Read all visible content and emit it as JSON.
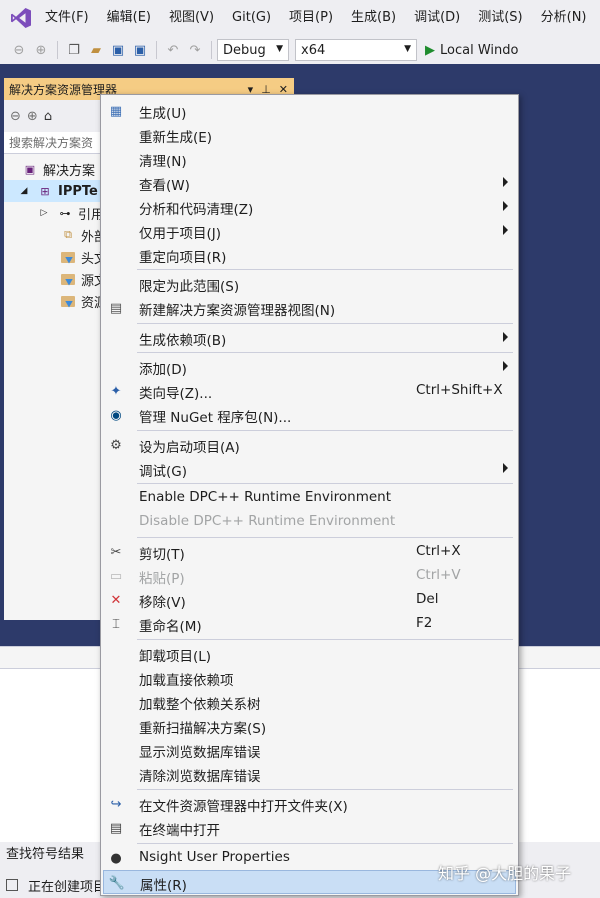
{
  "menubar": {
    "items": [
      "文件(F)",
      "编辑(E)",
      "视图(V)",
      "Git(G)",
      "项目(P)",
      "生成(B)",
      "调试(D)",
      "测试(S)",
      "分析(N)"
    ]
  },
  "toolbar": {
    "configuration": "Debug",
    "platform": "x64",
    "run_label": "Local Windo"
  },
  "solution_explorer": {
    "title": "解决方案资源管理器",
    "search_placeholder": "搜索解决方案资",
    "tree": [
      {
        "label": "解决方案",
        "icon": "solution-icon"
      },
      {
        "label": "IPPTe",
        "icon": "project-icon",
        "selected": true
      },
      {
        "label": "引用",
        "icon": "references-icon"
      },
      {
        "label": "外部",
        "icon": "external-deps-icon"
      },
      {
        "label": "头文",
        "icon": "folder-icon"
      },
      {
        "label": "源文",
        "icon": "folder-icon"
      },
      {
        "label": "资源",
        "icon": "folder-icon"
      }
    ]
  },
  "lower": {
    "symbols_tab": "查找符号结果",
    "status": "正在创建项目"
  },
  "context_menu": {
    "items": [
      {
        "label": "生成(U)",
        "icon": "build-icon"
      },
      {
        "label": "重新生成(E)"
      },
      {
        "label": "清理(N)"
      },
      {
        "label": "查看(W)",
        "submenu": true
      },
      {
        "label": "分析和代码清理(Z)",
        "submenu": true
      },
      {
        "label": "仅用于项目(J)",
        "submenu": true
      },
      {
        "label": "重定向项目(R)"
      },
      {
        "label": "限定为此范围(S)"
      },
      {
        "label": "新建解决方案资源管理器视图(N)",
        "icon": "new-view-icon"
      },
      {
        "label": "生成依赖项(B)",
        "submenu": true
      },
      {
        "label": "添加(D)",
        "submenu": true
      },
      {
        "label": "类向导(Z)...",
        "shortcut": "Ctrl+Shift+X",
        "icon": "class-wizard-icon"
      },
      {
        "label": "管理 NuGet 程序包(N)...",
        "icon": "nuget-icon"
      },
      {
        "label": "设为启动项目(A)",
        "icon": "gear-icon"
      },
      {
        "label": "调试(G)",
        "submenu": true
      },
      {
        "label": "Enable DPC++ Runtime Environment"
      },
      {
        "label": "Disable DPC++ Runtime Environment",
        "disabled": true
      },
      {
        "label": "剪切(T)",
        "shortcut": "Ctrl+X",
        "icon": "scissors-icon"
      },
      {
        "label": "粘贴(P)",
        "shortcut": "Ctrl+V",
        "icon": "paste-icon",
        "disabled": true
      },
      {
        "label": "移除(V)",
        "shortcut": "Del",
        "icon": "remove-icon"
      },
      {
        "label": "重命名(M)",
        "shortcut": "F2",
        "icon": "rename-icon"
      },
      {
        "label": "卸载项目(L)"
      },
      {
        "label": "加载直接依赖项"
      },
      {
        "label": "加载整个依赖关系树"
      },
      {
        "label": "重新扫描解决方案(S)"
      },
      {
        "label": "显示浏览数据库错误"
      },
      {
        "label": "清除浏览数据库错误"
      },
      {
        "label": "在文件资源管理器中打开文件夹(X)",
        "icon": "open-folder-icon"
      },
      {
        "label": "在终端中打开",
        "icon": "terminal-icon"
      },
      {
        "label": "Nsight User Properties",
        "icon": "nsight-icon"
      },
      {
        "label": "属性(R)",
        "icon": "wrench-icon",
        "highlighted": true
      }
    ]
  },
  "watermark": "知乎 @大胆的果子"
}
